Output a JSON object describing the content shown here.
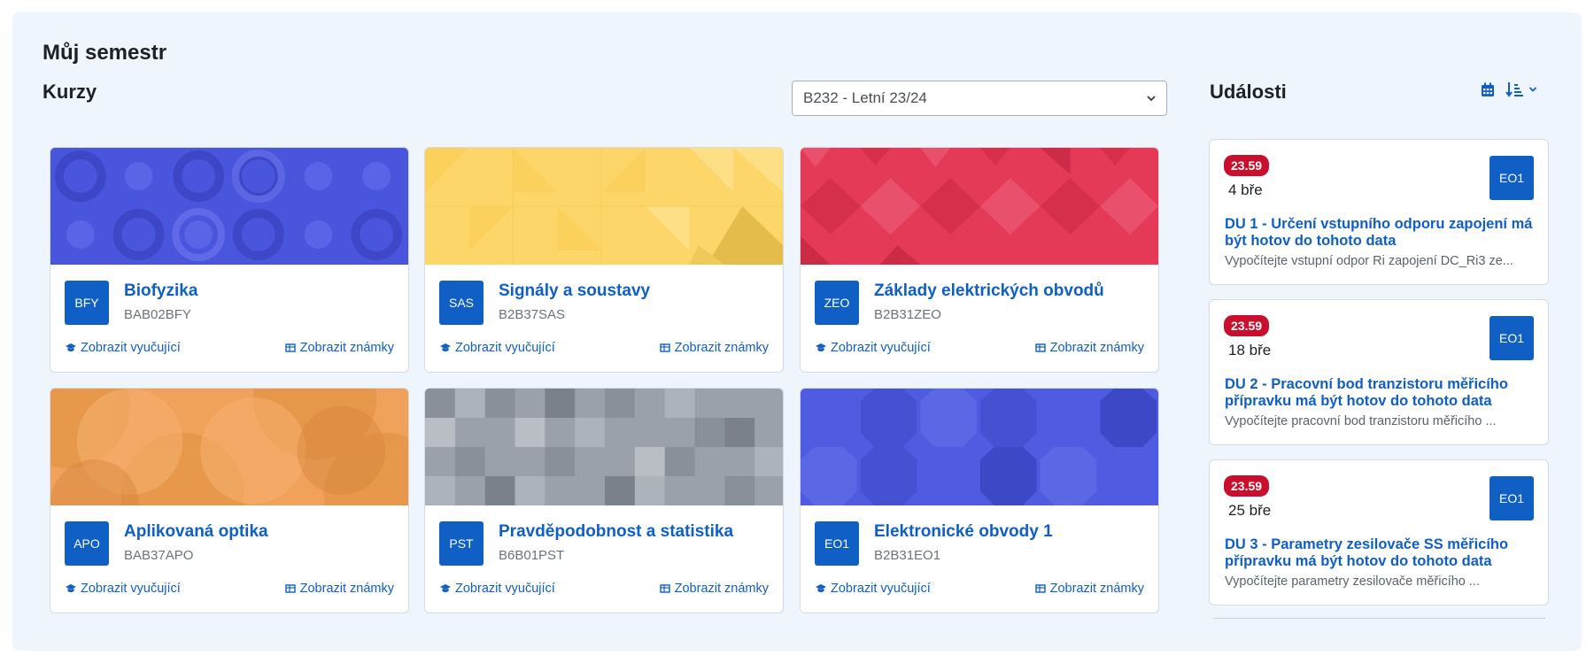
{
  "page": {
    "title": "Můj semestr"
  },
  "courses": {
    "heading": "Kurzy",
    "semester_select": "B232 - Letní 23/24",
    "items": [
      {
        "abbr": "BFY",
        "name": "Biofyzika",
        "code": "BAB02BFY",
        "teachers_link": "Zobrazit vyučující",
        "grades_link": "Zobrazit známky",
        "color": "#4a55dd"
      },
      {
        "abbr": "SAS",
        "name": "Signály a soustavy",
        "code": "B2B37SAS",
        "teachers_link": "Zobrazit vyučující",
        "grades_link": "Zobrazit známky",
        "color": "#fdd66a"
      },
      {
        "abbr": "ZEO",
        "name": "Základy elektrických obvodů",
        "code": "B2B31ZEO",
        "teachers_link": "Zobrazit vyučující",
        "grades_link": "Zobrazit známky",
        "color": "#e43a57"
      },
      {
        "abbr": "APO",
        "name": "Aplikovaná optika",
        "code": "BAB37APO",
        "teachers_link": "Zobrazit vyučující",
        "grades_link": "Zobrazit známky",
        "color": "#f0a15a"
      },
      {
        "abbr": "PST",
        "name": "Pravděpodobnost a statistika",
        "code": "B6B01PST",
        "teachers_link": "Zobrazit vyučující",
        "grades_link": "Zobrazit známky",
        "color": "#9ba1aa"
      },
      {
        "abbr": "EO1",
        "name": "Elektronické obvody 1",
        "code": "B2B31EO1",
        "teachers_link": "Zobrazit vyučující",
        "grades_link": "Zobrazit známky",
        "color": "#4f5be0"
      }
    ]
  },
  "events": {
    "heading": "Události",
    "icons": [
      "calendar-icon",
      "sort-ascending-icon",
      "chevron-down-icon"
    ],
    "items": [
      {
        "time": "23.59",
        "date": "4 bře",
        "badge": "EO1",
        "title": "DU 1 - Určení vstupního odporu zapojení má být hotov do tohoto data",
        "desc": "Vypočítejte vstupní odpor Ri zapojení DC_Ri3 ze..."
      },
      {
        "time": "23.59",
        "date": "18 bře",
        "badge": "EO1",
        "title": "DU 2 - Pracovní bod tranzistoru měřicího přípravku má být hotov do tohoto data",
        "desc": "Vypočítejte pracovní bod tranzistoru měřicího ..."
      },
      {
        "time": "23.59",
        "date": "25 bře",
        "badge": "EO1",
        "title": "DU 3 - Parametry zesilovače SS měřicího přípravku má být hotov do tohoto data",
        "desc": "Vypočítejte parametry zesilovače měřicího ..."
      }
    ]
  }
}
